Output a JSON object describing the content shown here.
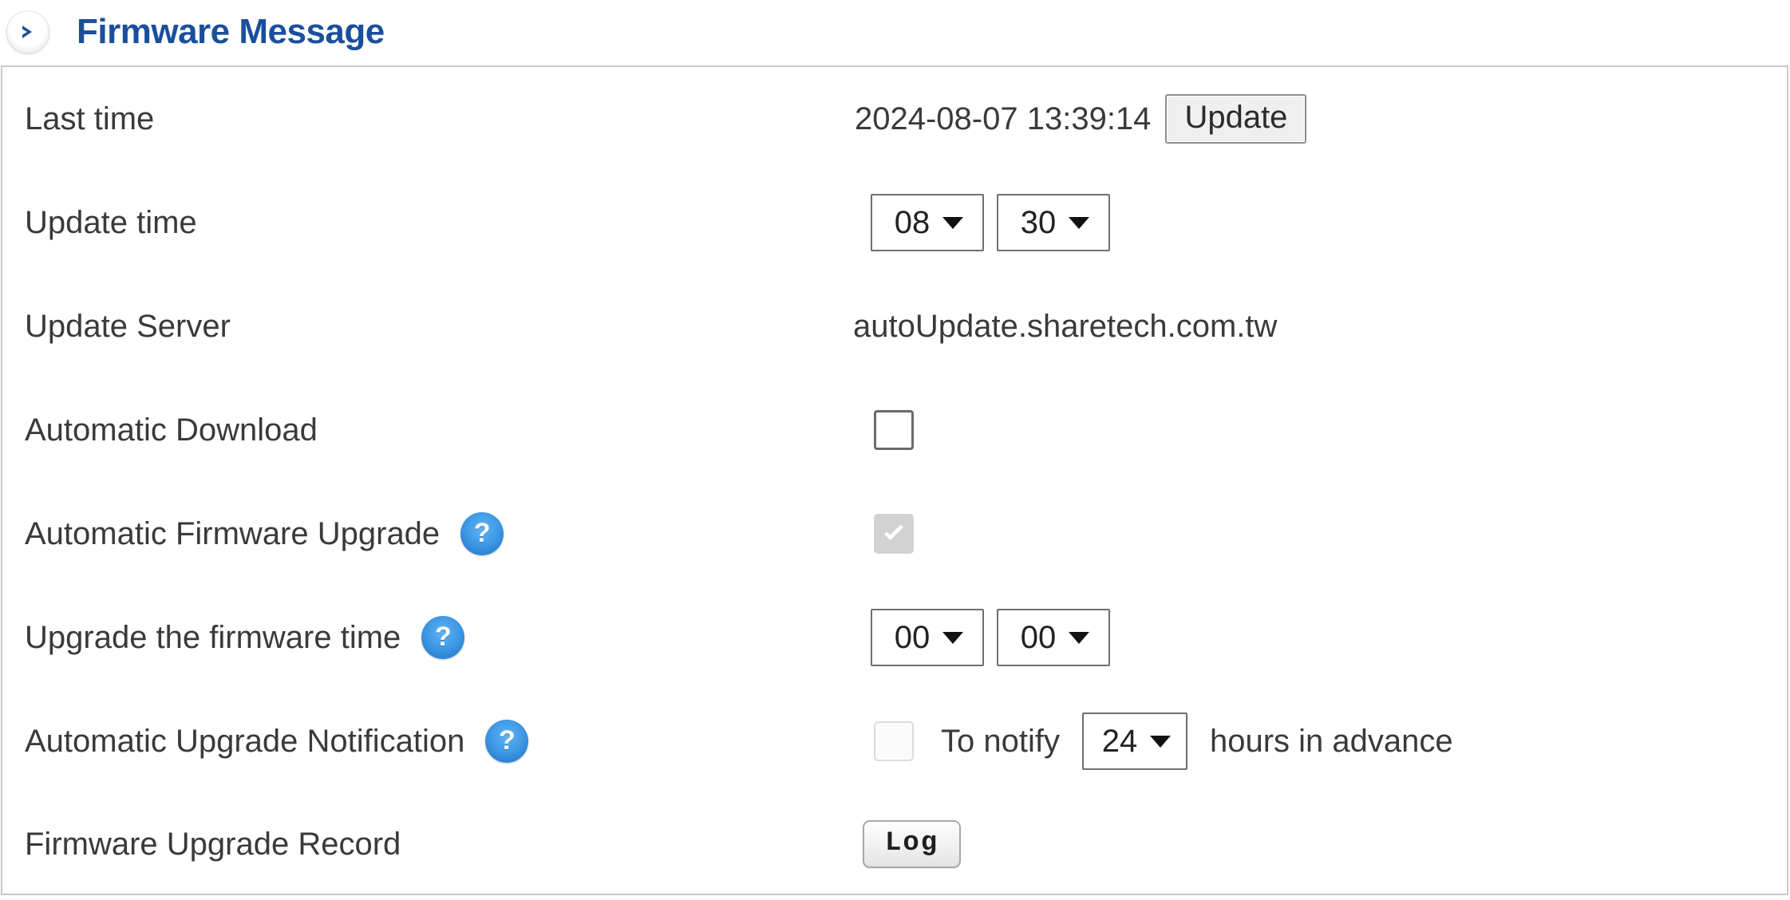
{
  "header": {
    "title": "Firmware Message",
    "toggle_icon": "chevron-right-circle-icon",
    "title_color": "#1a4f9c"
  },
  "rows": {
    "last_time": {
      "label": "Last time",
      "value": "2024-08-07 13:39:14",
      "button_label": "Update"
    },
    "update_time": {
      "label": "Update time",
      "hour": "08",
      "minute": "30"
    },
    "update_server": {
      "label": "Update Server",
      "value": "autoUpdate.sharetech.com.tw"
    },
    "automatic_download": {
      "label": "Automatic Download",
      "checked": false,
      "disabled": false
    },
    "automatic_firmware_upgrade": {
      "label": "Automatic Firmware Upgrade",
      "help_icon": "question-mark-icon",
      "checked": true,
      "disabled": true
    },
    "upgrade_firmware_time": {
      "label": "Upgrade the firmware time",
      "help_icon": "question-mark-icon",
      "hour": "00",
      "minute": "00"
    },
    "automatic_upgrade_notification": {
      "label": "Automatic Upgrade Notification",
      "help_icon": "question-mark-icon",
      "checked": false,
      "disabled": true,
      "prefix_text": "To notify",
      "hours": "24",
      "suffix_text": "hours in advance"
    },
    "firmware_upgrade_record": {
      "label": "Firmware Upgrade Record",
      "button_label": "Log"
    }
  }
}
